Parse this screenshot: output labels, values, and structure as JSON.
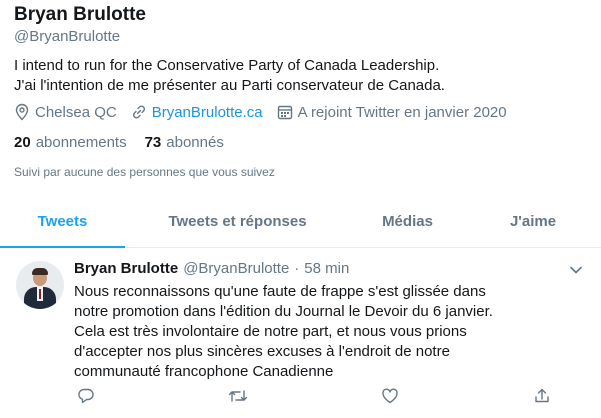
{
  "profile": {
    "name": "Bryan Brulotte",
    "handle": "@BryanBrulotte",
    "bio_line1": "I intend to run for the Conservative Party of Canada Leadership.",
    "bio_line2": "J'ai l'intention de me présenter au Parti conservateur de Canada.",
    "location": "Chelsea QC",
    "website": "BryanBrulotte.ca",
    "joined": "A rejoint Twitter en janvier 2020",
    "following_count": "20",
    "following_label": "abonnements",
    "followers_count": "73",
    "followers_label": "abonnés",
    "followed_by": "Suivi par aucune des personnes que vous suivez"
  },
  "tabs": [
    {
      "label": "Tweets",
      "active": true
    },
    {
      "label": "Tweets et réponses",
      "active": false
    },
    {
      "label": "Médias",
      "active": false
    },
    {
      "label": "J'aime",
      "active": false
    }
  ],
  "tweet": {
    "author_name": "Bryan Brulotte",
    "author_handle": "@BryanBrulotte",
    "separator": "·",
    "time": "58 min",
    "text": "Nous reconnaissons qu'une faute de frappe s'est glissée dans notre promotion dans l'édition du Journal le Devoir du 6 janvier. Cela est très involontaire de notre part, et nous vous prions d'accepter nos plus sincères excuses à l'endroit de notre communauté francophone Canadienne"
  },
  "icons": {
    "location": "location-pin-icon",
    "link": "link-icon",
    "calendar": "calendar-icon",
    "caret": "chevron-down-icon",
    "reply": "reply-icon",
    "retweet": "retweet-icon",
    "like": "like-icon",
    "share": "share-icon"
  },
  "colors": {
    "accent": "#1da1f2",
    "link": "#1b95e0",
    "muted": "#657786",
    "text": "#14171a"
  }
}
